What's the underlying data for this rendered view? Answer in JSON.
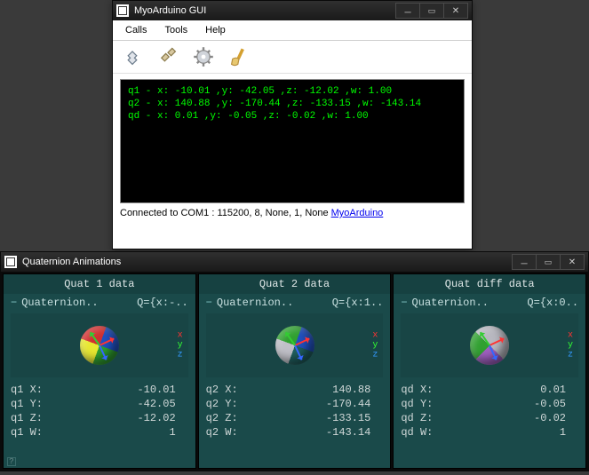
{
  "win1": {
    "title": "MyoArduino GUI",
    "menu": {
      "calls": "Calls",
      "tools": "Tools",
      "help": "Help"
    },
    "console": {
      "line1": "q1 - x: -10.01 ,y: -42.05 ,z: -12.02 ,w: 1.00",
      "line2": "q2 - x: 140.88 ,y: -170.44 ,z: -133.15 ,w: -143.14",
      "line3": "qd - x: 0.01 ,y: -0.05 ,z: -0.02 ,w: 1.00"
    },
    "status": "Connected to COM1 : 115200, 8, None, 1, None",
    "link": "MyoArduino"
  },
  "win2": {
    "title": "Quaternion Animations",
    "panels": [
      {
        "title": "Quat 1 data",
        "qname": "Quaternion..",
        "qshort": "Q={x:-..",
        "prefix": "q1",
        "vals": {
          "X": "-10.01",
          "Y": "-42.05",
          "Z": "-12.02",
          "W": "1"
        }
      },
      {
        "title": "Quat 2 data",
        "qname": "Quaternion..",
        "qshort": "Q={x:1..",
        "prefix": "q2",
        "vals": {
          "X": "140.88",
          "Y": "-170.44",
          "Z": "-133.15",
          "W": "-143.14"
        }
      },
      {
        "title": "Quat diff data",
        "qname": "Quaternion..",
        "qshort": "Q={x:0..",
        "prefix": "qd",
        "vals": {
          "X": "0.01",
          "Y": "-0.05",
          "Z": "-0.02",
          "W": "1"
        }
      }
    ],
    "axes": {
      "x": "x",
      "y": "y",
      "z": "z"
    }
  },
  "chart_data": [
    {
      "type": "table",
      "title": "Quat 1 data",
      "series": [
        {
          "name": "q1",
          "x": -10.01,
          "y": -42.05,
          "z": -12.02,
          "w": 1.0
        }
      ]
    },
    {
      "type": "table",
      "title": "Quat 2 data",
      "series": [
        {
          "name": "q2",
          "x": 140.88,
          "y": -170.44,
          "z": -133.15,
          "w": -143.14
        }
      ]
    },
    {
      "type": "table",
      "title": "Quat diff data",
      "series": [
        {
          "name": "qd",
          "x": 0.01,
          "y": -0.05,
          "z": -0.02,
          "w": 1.0
        }
      ]
    }
  ]
}
